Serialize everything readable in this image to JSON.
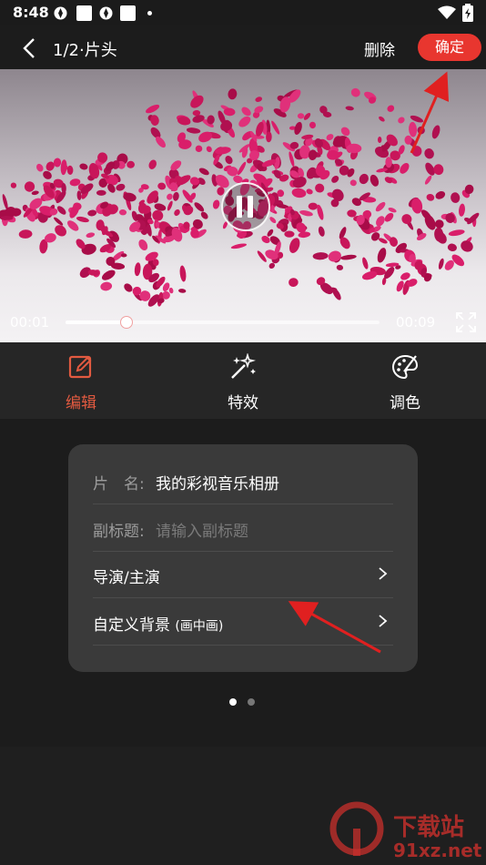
{
  "status_bar": {
    "time": "8:48"
  },
  "header": {
    "title": "1/2·片头",
    "delete_label": "删除",
    "confirm_label": "确定"
  },
  "player": {
    "current_time": "00:01",
    "total_time": "00:09",
    "progress": 0.19
  },
  "tabs": [
    {
      "label": "编辑",
      "icon": "edit-icon",
      "active": true
    },
    {
      "label": "特效",
      "icon": "magic-wand-icon",
      "active": false
    },
    {
      "label": "调色",
      "icon": "palette-icon",
      "active": false
    }
  ],
  "form": {
    "name_label": "片　名:",
    "name_value": "我的彩视音乐相册",
    "subtitle_label": "副标题:",
    "subtitle_placeholder": "请输入副标题",
    "director_label": "导演/主演",
    "background_label": "自定义背景",
    "background_note": "(画中画)"
  },
  "pager": {
    "count": 2,
    "active": 0
  },
  "watermark": {
    "logo": "9",
    "text_cn": "下载站",
    "text_url": "91xz.net"
  },
  "colors": {
    "accent": "#e8362f",
    "active_tab": "#e25a40",
    "background": "#1c1c1c",
    "card": "#3a3a3a",
    "petal": "#c8165a"
  }
}
